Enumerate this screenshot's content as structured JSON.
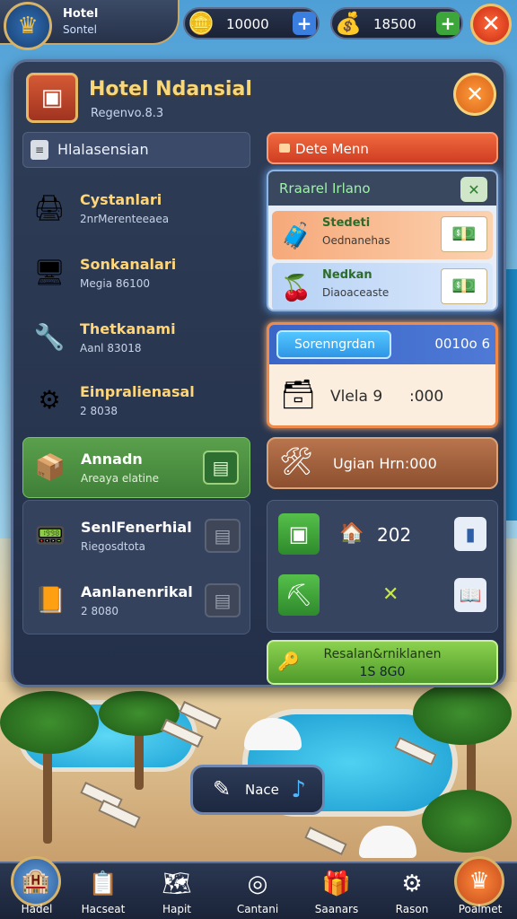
{
  "topbar": {
    "player_name": "Hotel",
    "player_sub": "Sontel",
    "coins_value": "10000",
    "gems_value": "18500"
  },
  "panel": {
    "title": "Hotel Ndansial",
    "subtitle": "Regenvo.8.3"
  },
  "left": {
    "header": "Hlalasensian",
    "items": [
      {
        "title": "Cystanlari",
        "sub": "2nrMerenteeaea"
      },
      {
        "title": "Sonkanalari",
        "sub": "Megia 86100"
      },
      {
        "title": "Thetkanami",
        "sub": "Aanl 83018"
      },
      {
        "title": "Einpralienasal",
        "sub": "2 8038"
      },
      {
        "title": "Annadn",
        "sub": "Areaya elatine"
      },
      {
        "title": "SenlFenerhial",
        "sub": "Riegosdtota"
      },
      {
        "title": "Aanlanenrikal",
        "sub": "2 8080"
      }
    ]
  },
  "right": {
    "sale_tab": "Dete Menn",
    "travel_title": "Rraarel Irlano",
    "offers": [
      {
        "title": "Stedeti",
        "sub": "Oednanehas"
      },
      {
        "title": "Nedkan",
        "sub": "Diaoaceaste"
      }
    ],
    "sort_button": "Sorenngrdan",
    "sort_value": "0010o 6",
    "sort_label": "Vlela 9",
    "sort_time": ":000",
    "upgrade_label": "Ugian Hrn:000",
    "resource_value": "202",
    "reward_title": "Resalan&rniklanen",
    "reward_sub": "1S 8G0"
  },
  "float_button": {
    "label": "Nace"
  },
  "nav": [
    {
      "label": "Hadel",
      "icon": "hotel-icon"
    },
    {
      "label": "Hacseat",
      "icon": "tasks-icon"
    },
    {
      "label": "Hapit",
      "icon": "map-icon"
    },
    {
      "label": "Cantani",
      "icon": "camera-icon"
    },
    {
      "label": "Saanars",
      "icon": "shop-icon"
    },
    {
      "label": "Rason",
      "icon": "gear-icon"
    },
    {
      "label": "Poalmet",
      "icon": "profile-icon"
    }
  ],
  "colors": {
    "panel_bg": "#2f3d57",
    "title_gold": "#f7d77b",
    "active_green": "#5aa04c",
    "sale_red": "#f06a3e",
    "sort_blue": "#3a66c8",
    "upgrade_brown": "#b8744d",
    "reward_green": "#8cd24f"
  }
}
